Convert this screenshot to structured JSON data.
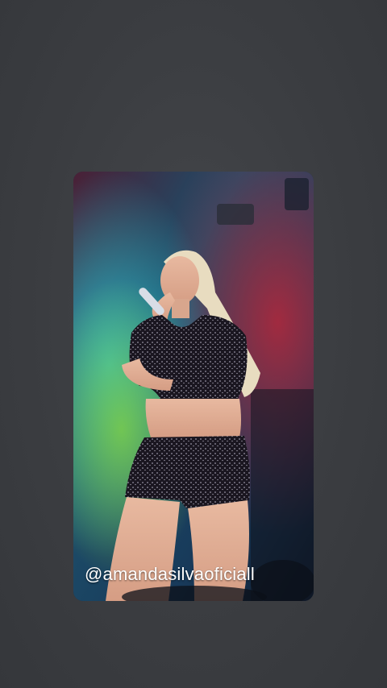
{
  "story": {
    "mention": "@amandasilvaoficiall"
  },
  "colors": {
    "background": "#3b3d41",
    "stage_red": "#8a2a3c",
    "stage_cyan": "#2fb8c8",
    "stage_green": "#7fd23a",
    "outfit_black": "#1a1620"
  }
}
